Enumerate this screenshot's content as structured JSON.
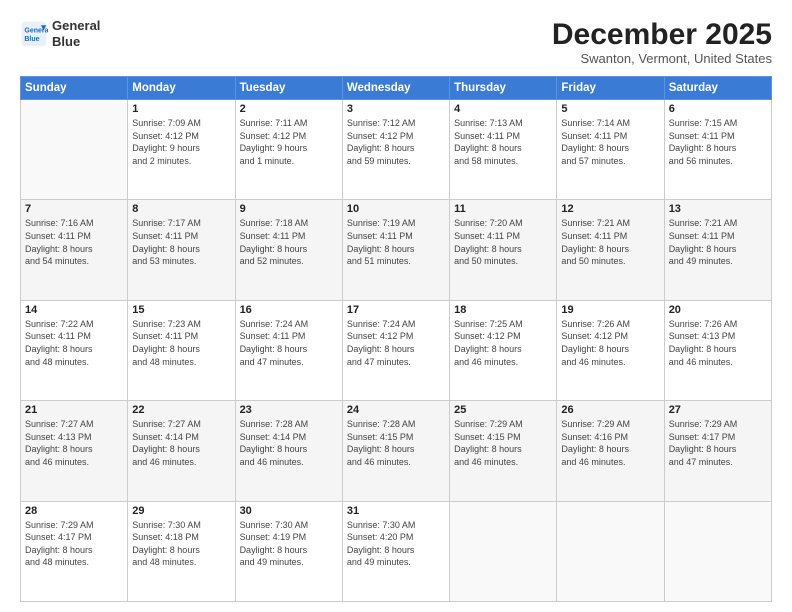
{
  "header": {
    "logo_line1": "General",
    "logo_line2": "Blue",
    "title": "December 2025",
    "subtitle": "Swanton, Vermont, United States"
  },
  "days_of_week": [
    "Sunday",
    "Monday",
    "Tuesday",
    "Wednesday",
    "Thursday",
    "Friday",
    "Saturday"
  ],
  "weeks": [
    [
      {
        "num": "",
        "info": ""
      },
      {
        "num": "1",
        "info": "Sunrise: 7:09 AM\nSunset: 4:12 PM\nDaylight: 9 hours\nand 2 minutes."
      },
      {
        "num": "2",
        "info": "Sunrise: 7:11 AM\nSunset: 4:12 PM\nDaylight: 9 hours\nand 1 minute."
      },
      {
        "num": "3",
        "info": "Sunrise: 7:12 AM\nSunset: 4:12 PM\nDaylight: 8 hours\nand 59 minutes."
      },
      {
        "num": "4",
        "info": "Sunrise: 7:13 AM\nSunset: 4:11 PM\nDaylight: 8 hours\nand 58 minutes."
      },
      {
        "num": "5",
        "info": "Sunrise: 7:14 AM\nSunset: 4:11 PM\nDaylight: 8 hours\nand 57 minutes."
      },
      {
        "num": "6",
        "info": "Sunrise: 7:15 AM\nSunset: 4:11 PM\nDaylight: 8 hours\nand 56 minutes."
      }
    ],
    [
      {
        "num": "7",
        "info": "Sunrise: 7:16 AM\nSunset: 4:11 PM\nDaylight: 8 hours\nand 54 minutes."
      },
      {
        "num": "8",
        "info": "Sunrise: 7:17 AM\nSunset: 4:11 PM\nDaylight: 8 hours\nand 53 minutes."
      },
      {
        "num": "9",
        "info": "Sunrise: 7:18 AM\nSunset: 4:11 PM\nDaylight: 8 hours\nand 52 minutes."
      },
      {
        "num": "10",
        "info": "Sunrise: 7:19 AM\nSunset: 4:11 PM\nDaylight: 8 hours\nand 51 minutes."
      },
      {
        "num": "11",
        "info": "Sunrise: 7:20 AM\nSunset: 4:11 PM\nDaylight: 8 hours\nand 50 minutes."
      },
      {
        "num": "12",
        "info": "Sunrise: 7:21 AM\nSunset: 4:11 PM\nDaylight: 8 hours\nand 50 minutes."
      },
      {
        "num": "13",
        "info": "Sunrise: 7:21 AM\nSunset: 4:11 PM\nDaylight: 8 hours\nand 49 minutes."
      }
    ],
    [
      {
        "num": "14",
        "info": "Sunrise: 7:22 AM\nSunset: 4:11 PM\nDaylight: 8 hours\nand 48 minutes."
      },
      {
        "num": "15",
        "info": "Sunrise: 7:23 AM\nSunset: 4:11 PM\nDaylight: 8 hours\nand 48 minutes."
      },
      {
        "num": "16",
        "info": "Sunrise: 7:24 AM\nSunset: 4:11 PM\nDaylight: 8 hours\nand 47 minutes."
      },
      {
        "num": "17",
        "info": "Sunrise: 7:24 AM\nSunset: 4:12 PM\nDaylight: 8 hours\nand 47 minutes."
      },
      {
        "num": "18",
        "info": "Sunrise: 7:25 AM\nSunset: 4:12 PM\nDaylight: 8 hours\nand 46 minutes."
      },
      {
        "num": "19",
        "info": "Sunrise: 7:26 AM\nSunset: 4:12 PM\nDaylight: 8 hours\nand 46 minutes."
      },
      {
        "num": "20",
        "info": "Sunrise: 7:26 AM\nSunset: 4:13 PM\nDaylight: 8 hours\nand 46 minutes."
      }
    ],
    [
      {
        "num": "21",
        "info": "Sunrise: 7:27 AM\nSunset: 4:13 PM\nDaylight: 8 hours\nand 46 minutes."
      },
      {
        "num": "22",
        "info": "Sunrise: 7:27 AM\nSunset: 4:14 PM\nDaylight: 8 hours\nand 46 minutes."
      },
      {
        "num": "23",
        "info": "Sunrise: 7:28 AM\nSunset: 4:14 PM\nDaylight: 8 hours\nand 46 minutes."
      },
      {
        "num": "24",
        "info": "Sunrise: 7:28 AM\nSunset: 4:15 PM\nDaylight: 8 hours\nand 46 minutes."
      },
      {
        "num": "25",
        "info": "Sunrise: 7:29 AM\nSunset: 4:15 PM\nDaylight: 8 hours\nand 46 minutes."
      },
      {
        "num": "26",
        "info": "Sunrise: 7:29 AM\nSunset: 4:16 PM\nDaylight: 8 hours\nand 46 minutes."
      },
      {
        "num": "27",
        "info": "Sunrise: 7:29 AM\nSunset: 4:17 PM\nDaylight: 8 hours\nand 47 minutes."
      }
    ],
    [
      {
        "num": "28",
        "info": "Sunrise: 7:29 AM\nSunset: 4:17 PM\nDaylight: 8 hours\nand 48 minutes."
      },
      {
        "num": "29",
        "info": "Sunrise: 7:30 AM\nSunset: 4:18 PM\nDaylight: 8 hours\nand 48 minutes."
      },
      {
        "num": "30",
        "info": "Sunrise: 7:30 AM\nSunset: 4:19 PM\nDaylight: 8 hours\nand 49 minutes."
      },
      {
        "num": "31",
        "info": "Sunrise: 7:30 AM\nSunset: 4:20 PM\nDaylight: 8 hours\nand 49 minutes."
      },
      {
        "num": "",
        "info": ""
      },
      {
        "num": "",
        "info": ""
      },
      {
        "num": "",
        "info": ""
      }
    ]
  ]
}
